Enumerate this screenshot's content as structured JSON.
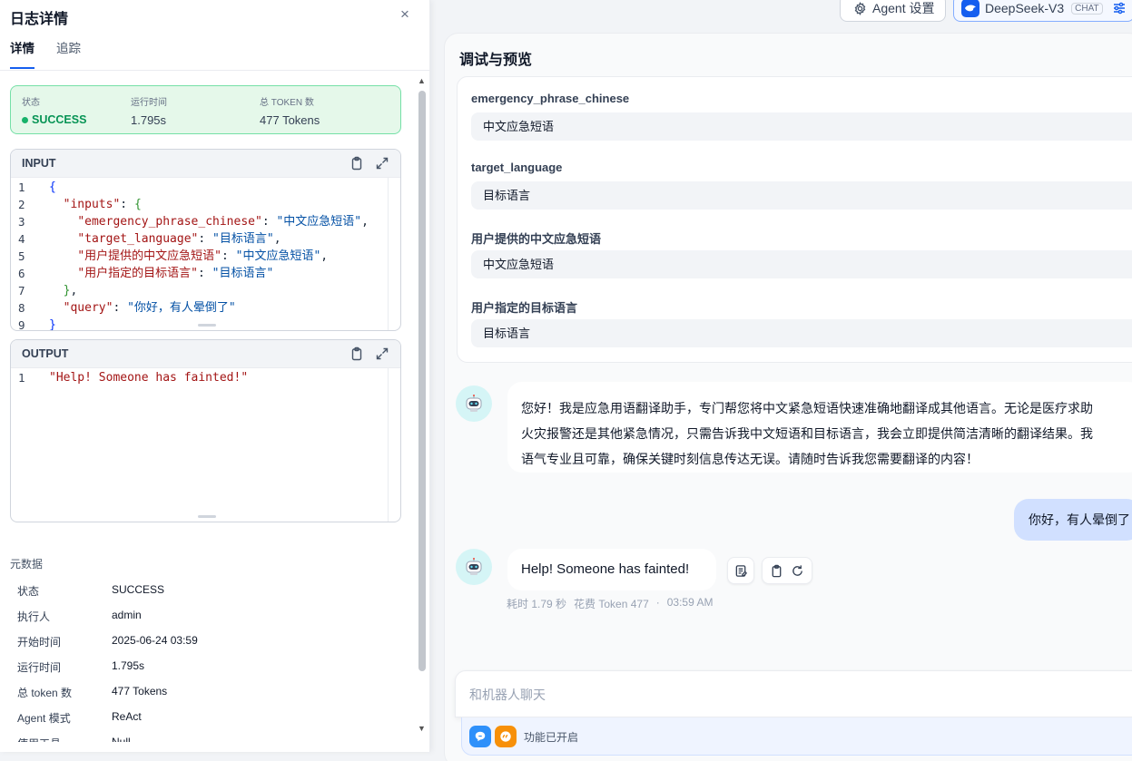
{
  "log": {
    "title": "日志详情",
    "close_glyph": "×",
    "tabs": [
      {
        "label": "详情"
      },
      {
        "label": "追踪"
      }
    ],
    "status": {
      "status_label": "状态",
      "status_value": "SUCCESS",
      "time_label": "运行时间",
      "time_value": "1.795s",
      "token_label": "总 TOKEN 数",
      "token_value": "477 Tokens"
    },
    "input": {
      "title": "INPUT",
      "lines": [
        {
          "n": "1",
          "parts": [
            {
              "t": "{",
              "c": "b1"
            }
          ]
        },
        {
          "n": "2",
          "parts": [
            {
              "t": "  ",
              "c": "p"
            },
            {
              "t": "\"inputs\"",
              "c": "k"
            },
            {
              "t": ": ",
              "c": "p"
            },
            {
              "t": "{",
              "c": "b2"
            }
          ]
        },
        {
          "n": "3",
          "parts": [
            {
              "t": "    ",
              "c": "p"
            },
            {
              "t": "\"emergency_phrase_chinese\"",
              "c": "k"
            },
            {
              "t": ": ",
              "c": "p"
            },
            {
              "t": "\"中文应急短语\"",
              "c": "s"
            },
            {
              "t": ",",
              "c": "p"
            }
          ]
        },
        {
          "n": "4",
          "parts": [
            {
              "t": "    ",
              "c": "p"
            },
            {
              "t": "\"target_language\"",
              "c": "k"
            },
            {
              "t": ": ",
              "c": "p"
            },
            {
              "t": "\"目标语言\"",
              "c": "s"
            },
            {
              "t": ",",
              "c": "p"
            }
          ]
        },
        {
          "n": "5",
          "parts": [
            {
              "t": "    ",
              "c": "p"
            },
            {
              "t": "\"用户提供的中文应急短语\"",
              "c": "k"
            },
            {
              "t": ": ",
              "c": "p"
            },
            {
              "t": "\"中文应急短语\"",
              "c": "s"
            },
            {
              "t": ",",
              "c": "p"
            }
          ]
        },
        {
          "n": "6",
          "parts": [
            {
              "t": "    ",
              "c": "p"
            },
            {
              "t": "\"用户指定的目标语言\"",
              "c": "k"
            },
            {
              "t": ": ",
              "c": "p"
            },
            {
              "t": "\"目标语言\"",
              "c": "s"
            }
          ]
        },
        {
          "n": "7",
          "parts": [
            {
              "t": "  ",
              "c": "p"
            },
            {
              "t": "}",
              "c": "b2"
            },
            {
              "t": ",",
              "c": "p"
            }
          ]
        },
        {
          "n": "8",
          "parts": [
            {
              "t": "  ",
              "c": "p"
            },
            {
              "t": "\"query\"",
              "c": "k"
            },
            {
              "t": ": ",
              "c": "p"
            },
            {
              "t": "\"你好，有人晕倒了\"",
              "c": "s"
            }
          ]
        },
        {
          "n": "9",
          "parts": [
            {
              "t": "}",
              "c": "b1"
            }
          ]
        }
      ]
    },
    "output": {
      "title": "OUTPUT",
      "lines": [
        {
          "n": "1",
          "parts": [
            {
              "t": "\"Help! Someone has fainted!\"",
              "c": "k"
            }
          ]
        }
      ]
    },
    "metadata": {
      "title": "元数据",
      "rows": [
        {
          "k": "状态",
          "v": "SUCCESS"
        },
        {
          "k": "执行人",
          "v": "admin"
        },
        {
          "k": "开始时间",
          "v": "2025-06-24 03:59"
        },
        {
          "k": "运行时间",
          "v": "1.795s"
        },
        {
          "k": "总 token 数",
          "v": "477 Tokens"
        },
        {
          "k": "Agent 模式",
          "v": "ReAct"
        },
        {
          "k": "使用工具",
          "v": "Null"
        }
      ]
    }
  },
  "header": {
    "agent_settings_label": "Agent 设置",
    "model_name": "DeepSeek-V3",
    "model_badge": "CHAT"
  },
  "preview": {
    "title": "调试与预览",
    "variables": [
      {
        "label": "emergency_phrase_chinese",
        "value": "中文应急短语"
      },
      {
        "label": "target_language",
        "value": "目标语言"
      },
      {
        "label": "用户提供的中文应急短语",
        "value": "中文应急短语"
      },
      {
        "label": "用户指定的目标语言",
        "value": "目标语言"
      }
    ],
    "welcome_lines": [
      "您好！我是应急用语翻译助手，专门帮您将中文紧急短语快速准确地翻译成其他语言。无论是医疗求助",
      "火灾报警还是其他紧急情况，只需告诉我中文短语和目标语言，我会立即提供简洁清晰的翻译结果。我",
      "语气专业且可靠，确保关键时刻信息传达无误。请随时告诉我您需要翻译的内容！"
    ],
    "user_message": "你好，有人晕倒了",
    "reply": "Help! Someone has fainted!",
    "reply_meta": {
      "time": "耗时 1.79 秒",
      "tokens": "花费 Token 477",
      "sep": "·",
      "clock": "03:59 AM"
    },
    "input_placeholder": "和机器人聊天",
    "features_label": "功能已开启"
  },
  "colors": {
    "accent": "#155eef",
    "success": "#17b26a",
    "user_bubble": "#d1e0ff",
    "feature_blue": "#2e90fa",
    "feature_orange": "#f79009"
  },
  "icons": [
    "close-icon",
    "clipboard-icon",
    "expand-icon",
    "gear-icon",
    "deepseek-logo-icon",
    "sliders-icon",
    "robot-avatar-icon",
    "notes-icon",
    "copy-icon",
    "refresh-icon",
    "chat-feature-icon",
    "quote-feature-icon"
  ]
}
